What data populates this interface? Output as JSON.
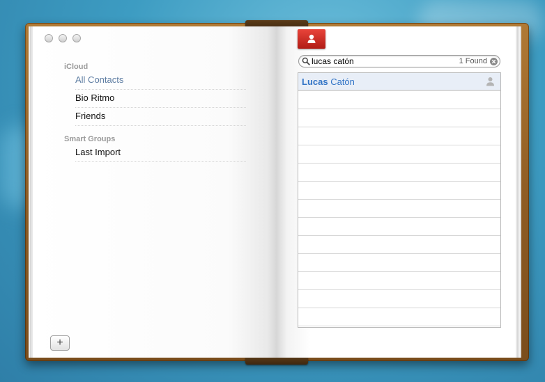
{
  "window": {
    "traffic_lights": [
      "close",
      "minimize",
      "zoom"
    ]
  },
  "sidebar": {
    "sections": [
      {
        "header": "iCloud",
        "items": [
          "All Contacts",
          "Bio Ritmo",
          "Friends"
        ],
        "selected": "All Contacts"
      },
      {
        "header": "Smart Groups",
        "items": [
          "Last Import"
        ]
      }
    ],
    "add_button_label": "+"
  },
  "toolbar": {
    "card_icon": "person-card-icon"
  },
  "search": {
    "value": "lucas catón",
    "result_count": "1 Found"
  },
  "contacts": [
    {
      "first": "Lucas",
      "last": "Catón",
      "selected": true
    }
  ],
  "colors": {
    "accent": "#3274c6",
    "selected_group": "#5f7ea3",
    "card_button": "#d0302a",
    "leather": "#8f5d24"
  }
}
